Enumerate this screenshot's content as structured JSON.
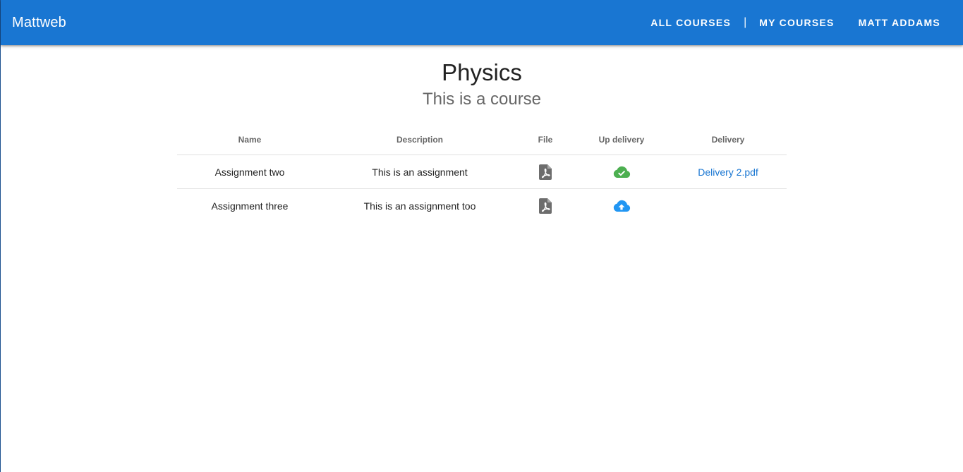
{
  "header": {
    "brand": "Mattweb",
    "nav": {
      "all_courses": "ALL COURSES",
      "separator": "|",
      "my_courses": "MY COURSES",
      "user": "MATT ADDAMS"
    },
    "color": "#1976d2"
  },
  "course": {
    "title": "Physics",
    "subtitle": "This is a course"
  },
  "table": {
    "columns": [
      "Name",
      "Description",
      "File",
      "Up delivery",
      "Delivery"
    ],
    "rows": [
      {
        "name": "Assignment two",
        "description": "This is an assignment",
        "file_icon": "pdf-file-icon",
        "upload_icon": "cloud-check-icon",
        "upload_color": "#4caf50",
        "delivery": "Delivery 2.pdf"
      },
      {
        "name": "Assignment three",
        "description": "This is an assignment too",
        "file_icon": "pdf-file-icon",
        "upload_icon": "cloud-upload-icon",
        "upload_color": "#2196f3",
        "delivery": ""
      }
    ]
  }
}
